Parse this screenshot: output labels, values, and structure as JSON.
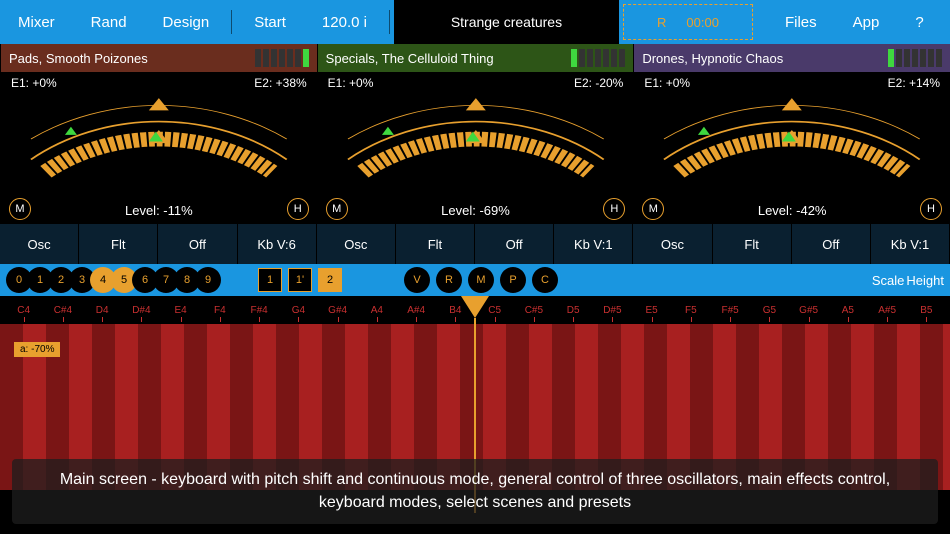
{
  "topbar": {
    "mixer": "Mixer",
    "rand": "Rand",
    "design": "Design",
    "start": "Start",
    "tempo": "120.0 i",
    "patch": "Strange creatures",
    "rec": "R",
    "time": "00:00",
    "files": "Files",
    "app": "App",
    "help": "?"
  },
  "osc": [
    {
      "title": "Pads, Smooth Poizones",
      "e1": "E1: +0%",
      "e2": "E2: +38%",
      "level": "Level: -11%",
      "meter": [
        0,
        0,
        0,
        0,
        0,
        0,
        1
      ]
    },
    {
      "title": "Specials, The Celluloid Thing",
      "e1": "E1: +0%",
      "e2": "E2: -20%",
      "level": "Level: -69%",
      "meter": [
        1,
        0,
        0,
        0,
        0,
        0,
        0
      ]
    },
    {
      "title": "Drones, Hypnotic Chaos",
      "e1": "E1: +0%",
      "e2": "E2: +14%",
      "level": "Level: -42%",
      "meter": [
        1,
        0,
        0,
        0,
        0,
        0,
        0
      ]
    }
  ],
  "sub": {
    "osc": "Osc",
    "flt": "Flt",
    "off": "Off",
    "kb": [
      "Kb V:6",
      "Kb V:1",
      "Kb V:1"
    ]
  },
  "dots": [
    "0",
    "1",
    "2",
    "3",
    "4",
    "5",
    "6",
    "7",
    "8",
    "9"
  ],
  "dotsOn": [
    4,
    5
  ],
  "nums": [
    "1",
    "1'",
    "2"
  ],
  "numOn": 2,
  "rounds": [
    "V",
    "R",
    "M",
    "P",
    "C"
  ],
  "scale": "Scale",
  "height": "Height",
  "notes": [
    "C4",
    "C#4",
    "D4",
    "D#4",
    "E4",
    "F4",
    "F#4",
    "G4",
    "G#4",
    "A4",
    "A#4",
    "B4",
    "C5",
    "C#5",
    "D5",
    "D#5",
    "E5",
    "F5",
    "F#5",
    "G5",
    "G#5",
    "A5",
    "A#5",
    "B5"
  ],
  "badge": "a: -70%",
  "mh": {
    "m": "M",
    "h": "H"
  },
  "caption": "Main screen - keyboard with pitch shift and continuous mode, general control of three oscillators, main effects control, keyboard modes, select scenes and presets"
}
